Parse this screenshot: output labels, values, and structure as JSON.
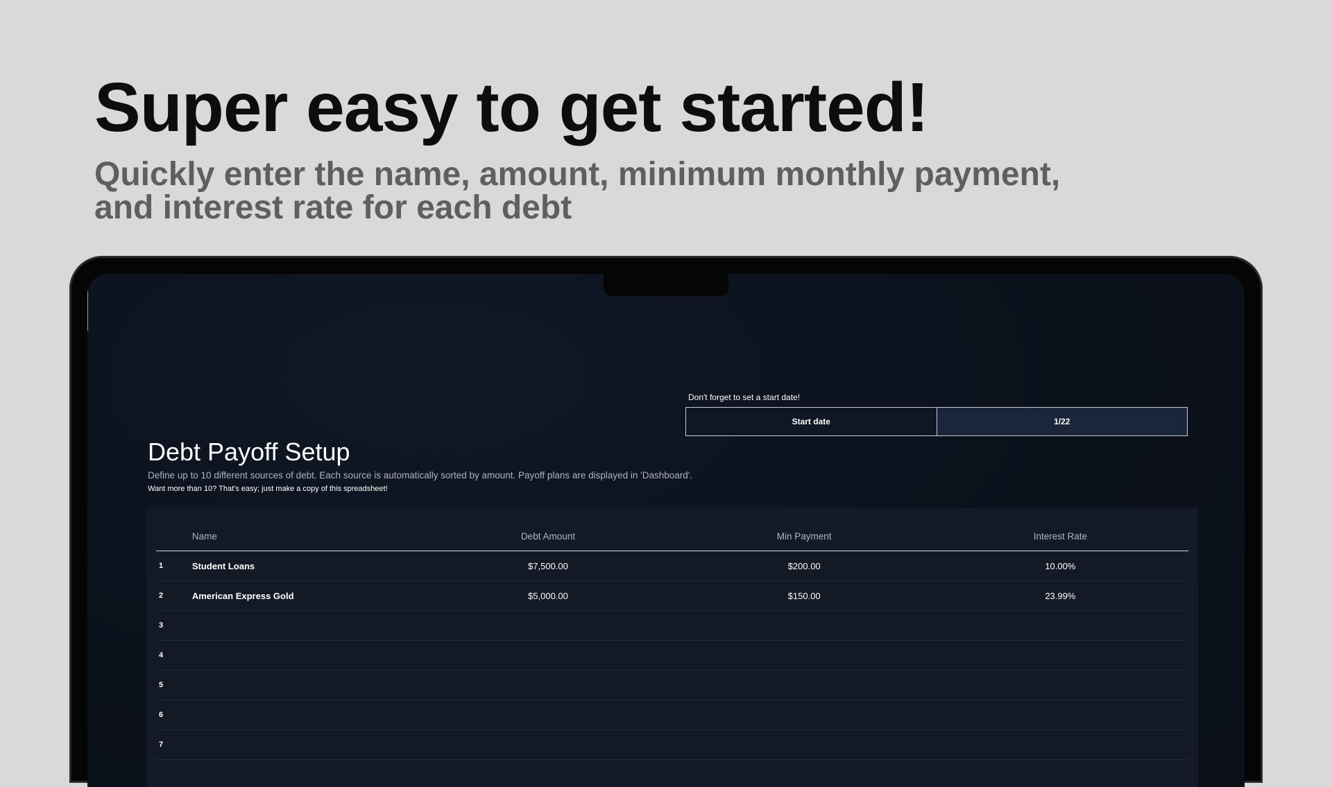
{
  "hero": {
    "headline": "Super easy to get started!",
    "subhead": "Quickly enter the name, amount, minimum monthly payment, and interest rate for each debt"
  },
  "sheet": {
    "reminder": "Don't forget to set a start date!",
    "start_date_label": "Start date",
    "start_date_value": "1/22",
    "title": "Debt Payoff Setup",
    "description": "Define up to 10 different sources of debt. Each source is automatically sorted by amount. Payoff plans are displayed in 'Dashboard'.",
    "note": "Want more than 10? That's easy; just make a copy of this spreadsheet!",
    "columns": {
      "name": "Name",
      "amount": "Debt Amount",
      "min_payment": "Min Payment",
      "rate": "Interest Rate"
    },
    "rows": [
      {
        "idx": "1",
        "name": "Student Loans",
        "amount": "$7,500.00",
        "min_payment": "$200.00",
        "rate": "10.00%"
      },
      {
        "idx": "2",
        "name": "American Express Gold",
        "amount": "$5,000.00",
        "min_payment": "$150.00",
        "rate": "23.99%"
      },
      {
        "idx": "3",
        "name": "",
        "amount": "",
        "min_payment": "",
        "rate": ""
      },
      {
        "idx": "4",
        "name": "",
        "amount": "",
        "min_payment": "",
        "rate": ""
      },
      {
        "idx": "5",
        "name": "",
        "amount": "",
        "min_payment": "",
        "rate": ""
      },
      {
        "idx": "6",
        "name": "",
        "amount": "",
        "min_payment": "",
        "rate": ""
      },
      {
        "idx": "7",
        "name": "",
        "amount": "",
        "min_payment": "",
        "rate": ""
      }
    ]
  },
  "colors": {
    "page_bg": "#d9d9d9",
    "headline": "#0d0d0d",
    "subhead": "#5f5f5f",
    "screen_bg": "#0b111b",
    "table_panel": "#131925",
    "date_value_bg": "#1c263a"
  }
}
